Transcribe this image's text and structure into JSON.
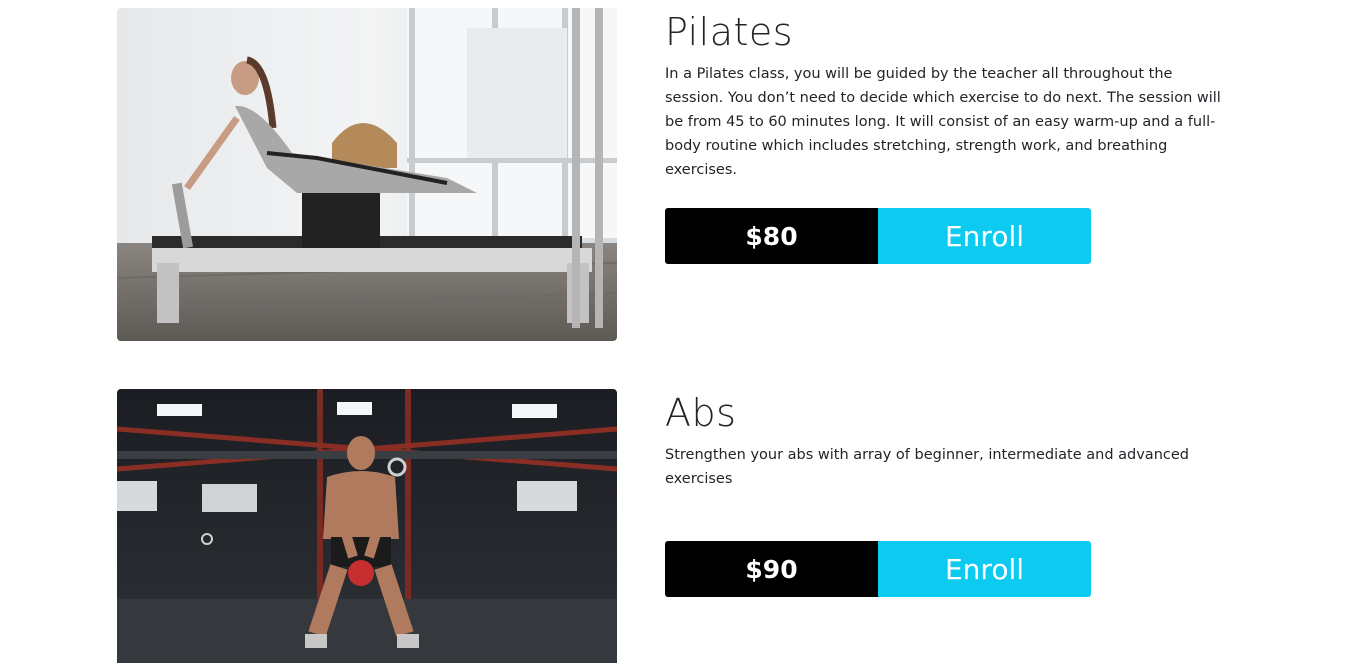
{
  "courses": [
    {
      "title": "Pilates",
      "description": "In a Pilates class, you will be guided by the teacher all throughout the session. You don’t need to decide which exercise to do next. The session will be from 45 to 60 minutes long. It will consist of an easy warm-up and a full-body routine which includes stretching, strength work, and breathing exercises.",
      "price": "$80",
      "enroll_label": "Enroll"
    },
    {
      "title": "Abs",
      "description": "Strengthen your abs with array of beginner, intermediate and advanced exercises",
      "price": "$90",
      "enroll_label": "Enroll"
    }
  ],
  "colors": {
    "price_bg": "#000000",
    "enroll_bg": "#0dcaf0",
    "text": "#212529"
  }
}
